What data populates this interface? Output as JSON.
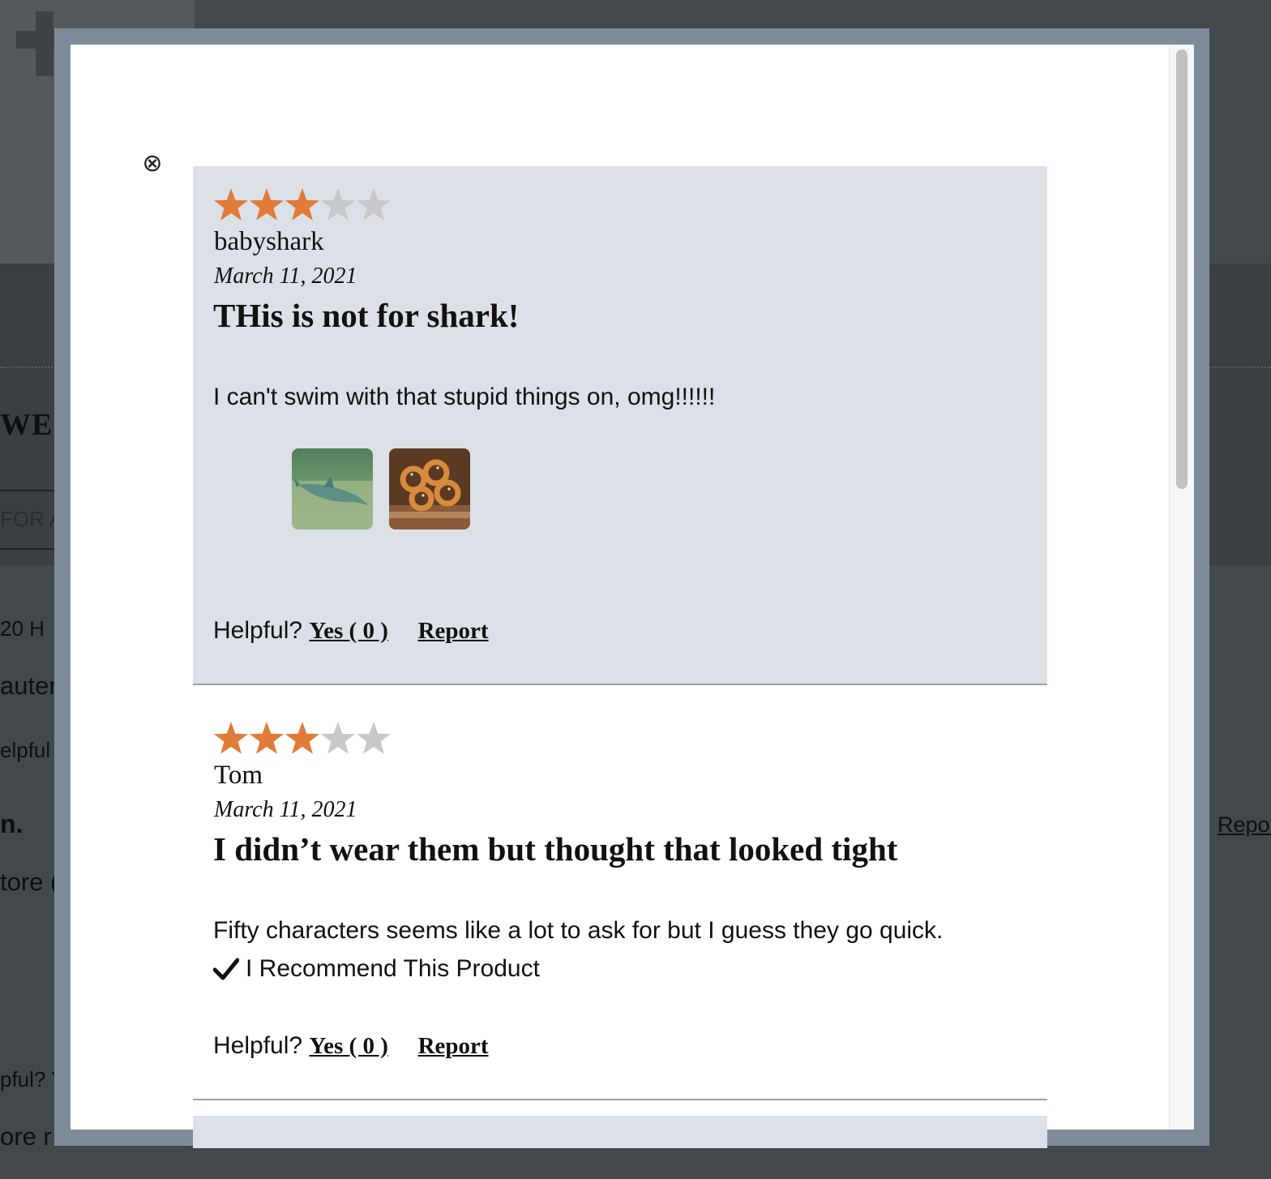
{
  "background_page": {
    "heading_fragment": "WE",
    "search_fragment": "FOR A",
    "count_fragment": "20   H",
    "author_fragment": "auter",
    "helpful_fragment": "elpful",
    "title_fragment": "n.",
    "body_fragment": "tore (",
    "helpful2_fragment": "pful?  Y",
    "more_fragment": "ore r",
    "report_fragment": "Repor"
  },
  "modal": {
    "close_icon": "close-circle-x-icon",
    "close_glyph": "⊗"
  },
  "reviews": [
    {
      "rating": 3,
      "max_rating": 5,
      "reviewer": "babyshark",
      "date": "March 11, 2021",
      "title": "THis is not for shark!",
      "body": "I can't swim with that stupid things on, omg!!!!!!",
      "photos": [
        "shark-photo",
        "pretzels-photo"
      ],
      "helpful_label": "Helpful?",
      "yes_label": "Yes ( 0 )",
      "report_label": "Report"
    },
    {
      "rating": 3,
      "max_rating": 5,
      "reviewer": "Tom",
      "date": "March 11, 2021",
      "title": "I didn’t wear them but thought that looked tight",
      "body": "Fifty characters seems like a lot to ask for but I guess they go quick.",
      "recommend_label": "I Recommend This Product",
      "helpful_label": "Helpful?",
      "yes_label": "Yes ( 0 )",
      "report_label": "Report"
    }
  ],
  "colors": {
    "star_filled": "#e07b39",
    "star_empty": "#c8c8c8",
    "review_highlight_bg": "#dbe1e7",
    "modal_frame": "#7e8c9a",
    "overlay": "#43484c"
  }
}
